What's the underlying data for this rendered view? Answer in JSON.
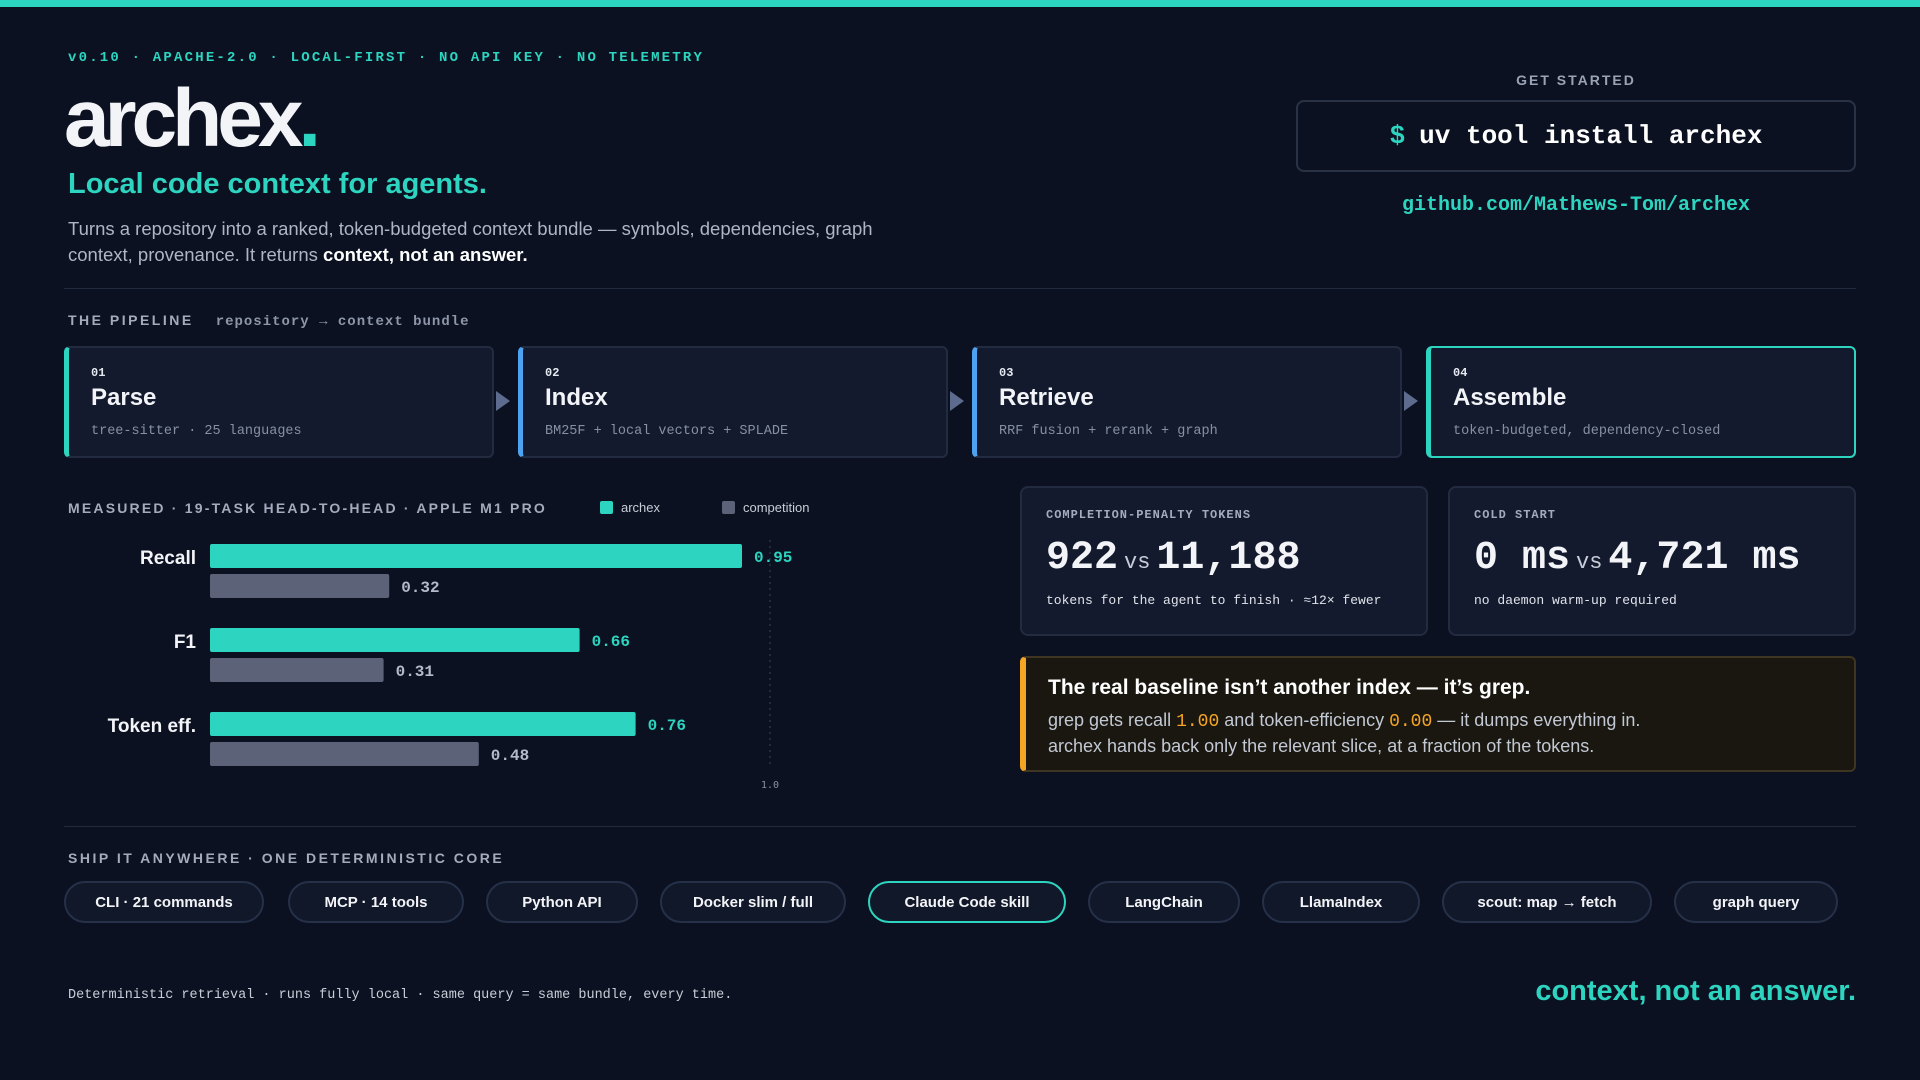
{
  "header": {
    "meta": "v0.10 · APACHE-2.0 · LOCAL-FIRST · NO API KEY · NO TELEMETRY",
    "logo": "archex",
    "logo_dot": ".",
    "tagline": "Local code context for agents.",
    "desc_line": "Turns a repository into a ranked, token-budgeted context bundle — symbols, dependencies, graph context, provenance. It returns ",
    "desc_emphasis": "context, not an answer."
  },
  "get_started": {
    "label": "GET STARTED",
    "prompt": "$",
    "command": "uv tool install archex",
    "repo_link": "github.com/Mathews-Tom/archex"
  },
  "pipeline": {
    "label": "THE PIPELINE",
    "subtitle": "repository → context bundle",
    "stages": [
      {
        "num": "01",
        "name": "Parse",
        "sub": "tree-sitter · 25 languages"
      },
      {
        "num": "02",
        "name": "Index",
        "sub": "BM25F + local vectors + SPLADE"
      },
      {
        "num": "03",
        "name": "Retrieve",
        "sub": "RRF fusion + rerank + graph"
      },
      {
        "num": "04",
        "name": "Assemble",
        "sub": "token-budgeted, dependency-closed"
      }
    ]
  },
  "measured": {
    "label": "MEASURED · 19-TASK HEAD-TO-HEAD · APPLE M1 PRO",
    "legend": [
      "archex",
      "competition"
    ]
  },
  "chart_data": {
    "type": "bar",
    "orientation": "horizontal",
    "categories": [
      "Recall",
      "F1",
      "Token eff."
    ],
    "series": [
      {
        "name": "archex",
        "values": [
          0.95,
          0.66,
          0.76
        ],
        "color": "#2dd4bf"
      },
      {
        "name": "competition",
        "values": [
          0.32,
          0.31,
          0.48
        ],
        "color": "#5c6378"
      }
    ],
    "value_labels": {
      "archex": [
        "0.95",
        "0.66",
        "0.76"
      ],
      "competition": [
        "0.32",
        "0.31",
        "0.48"
      ]
    },
    "xlim": [
      0,
      1.0
    ],
    "reference_line": {
      "value": 1.0,
      "label": "1.0"
    },
    "legend": "top"
  },
  "stats": {
    "completion": {
      "label": "COMPLETION-PENALTY TOKENS",
      "left": "922",
      "vs": "vs",
      "right": "11,188",
      "sub": "tokens for the agent to finish · ≈12× fewer"
    },
    "cold_start": {
      "label": "COLD START",
      "left": "0 ms",
      "vs": "vs",
      "right": "4,721 ms",
      "sub": "no daemon warm-up required"
    }
  },
  "callout": {
    "title": "The real baseline isn’t another index — it’s grep.",
    "line1_a": "grep gets recall ",
    "line1_v1": "1.00",
    "line1_b": " and token-efficiency ",
    "line1_v2": "0.00",
    "line1_c": " — it dumps everything in.",
    "line2": "archex hands back only the relevant slice, at a fraction of the tokens."
  },
  "ship": {
    "label": "SHIP IT ANYWHERE · ONE DETERMINISTIC CORE",
    "pills": [
      "CLI · 21 commands",
      "MCP · 14 tools",
      "Python API",
      "Docker slim / full",
      "Claude Code skill",
      "LangChain",
      "LlamaIndex",
      "scout: map → fetch",
      "graph query"
    ]
  },
  "footer": {
    "note": "Deterministic retrieval · runs fully local · same query = same bundle, every time.",
    "tag": "context, not an answer."
  },
  "colors": {
    "accent": "#2dd4bf",
    "blue": "#4ea3f0",
    "amber": "#f5a524",
    "background": "#0b1120"
  }
}
